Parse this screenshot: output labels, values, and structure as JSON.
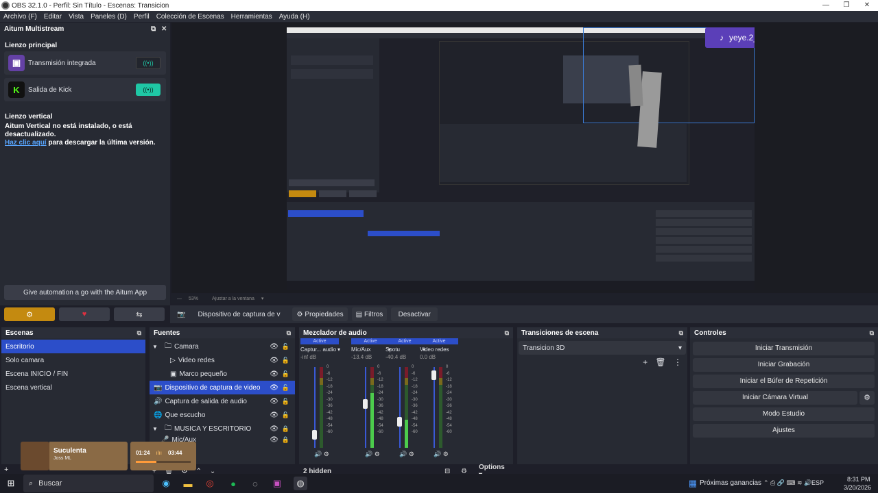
{
  "window": {
    "title": "OBS 32.1.0 - Perfil: Sin Título - Escenas: Transicion"
  },
  "menu": [
    "Archivo (F)",
    "Editar",
    "Vista",
    "Paneles (D)",
    "Perfil",
    "Colección de Escenas",
    "Herramientas",
    "Ayuda (H)"
  ],
  "multistream": {
    "title": "Aitum Multistream",
    "main_canvas_label": "Lienzo principal",
    "outputs": [
      {
        "label": "Transmisión integrada",
        "logo": "twitch-icon"
      },
      {
        "label": "Salida de Kick",
        "logo": "kick-icon"
      }
    ],
    "vertical_label": "Lienzo vertical",
    "vertical_msg": "Aitum Vertical no está instalado, o está desactualizado.",
    "link_text": "Haz clic aquí",
    "link_suffix": " para descargar la última versión.",
    "automation_btn": "Give automation a go with the Aitum App",
    "colors": {
      "twitch": "#6441a5",
      "kick": "#53fc18",
      "active_toggle": "#1fc7a5",
      "gold": "#c48a10"
    }
  },
  "preview": {
    "zoom": "53%",
    "fit_label": "Ajustar a la ventana",
    "tiktok_user": "yeye.2_"
  },
  "source_toolbar": {
    "source_name": "Dispositivo de captura de v",
    "properties": "Propiedades",
    "filters": "Filtros",
    "deactivate": "Desactivar"
  },
  "scenes": {
    "title": "Escenas",
    "items": [
      "Escritorio",
      "Solo camara",
      "Escena INICIO / FIN",
      "Escena vertical"
    ]
  },
  "sources": {
    "title": "Fuentes",
    "items": [
      {
        "label": "Camara",
        "icon": "folder-icon",
        "expand": "▼"
      },
      {
        "label": "Video redes",
        "icon": "play-icon",
        "expand": ""
      },
      {
        "label": "Marco pequeño",
        "icon": "image-icon",
        "expand": ""
      },
      {
        "label": "Dispositivo de captura de video con a",
        "icon": "camera-icon",
        "expand": ""
      },
      {
        "label": "Captura de salida de audio",
        "icon": "speaker-icon",
        "expand": ""
      },
      {
        "label": "Que escucho",
        "icon": "globe-icon",
        "expand": ""
      },
      {
        "label": "MUSICA Y ESCRITORIO",
        "icon": "folder-icon",
        "expand": "▼"
      },
      {
        "label": "Mic/Aux",
        "icon": "mic-icon",
        "expand": ""
      }
    ]
  },
  "mixer": {
    "title": "Mezclador de audio",
    "active_label": "Active",
    "channels": [
      {
        "name": "Captur... audio",
        "db": "-inf dB",
        "level": 0.0,
        "fader": 0.12
      },
      {
        "name": "Mic/Aux",
        "db": "-13.4 dB",
        "level": 0.68,
        "fader": 0.55
      },
      {
        "name": "Spotu",
        "db": "-40.4 dB",
        "level": 0.35,
        "fader": 0.3
      },
      {
        "name": "Video redes",
        "db": "0.0 dB",
        "level": 0.0,
        "fader": 0.95
      }
    ],
    "scale": [
      "0",
      "-6",
      "-12",
      "-18",
      "-24",
      "-30",
      "-36",
      "-42",
      "-48",
      "-54",
      "-60"
    ],
    "hidden": "2 hidden",
    "options": "Options"
  },
  "transitions": {
    "title": "Transiciones de escena",
    "current": "Transicion 3D"
  },
  "controls": {
    "title": "Controles",
    "buttons": [
      "Iniciar Transmisión",
      "Iniciar Grabación",
      "Iniciar el Búfer de Repetición",
      "Iniciar Cámara Virtual",
      "Modo Estudio",
      "Ajustes"
    ]
  },
  "now_playing": {
    "song": "Suculenta",
    "artist": "Joss ML",
    "elapsed": "01:24",
    "total": "03:44",
    "progress": 0.38
  },
  "taskbar": {
    "search_placeholder": "Buscar",
    "news": "Próximas ganancias",
    "lang": "ESP",
    "time": "8:31 PM",
    "date": "3/20/2026"
  }
}
